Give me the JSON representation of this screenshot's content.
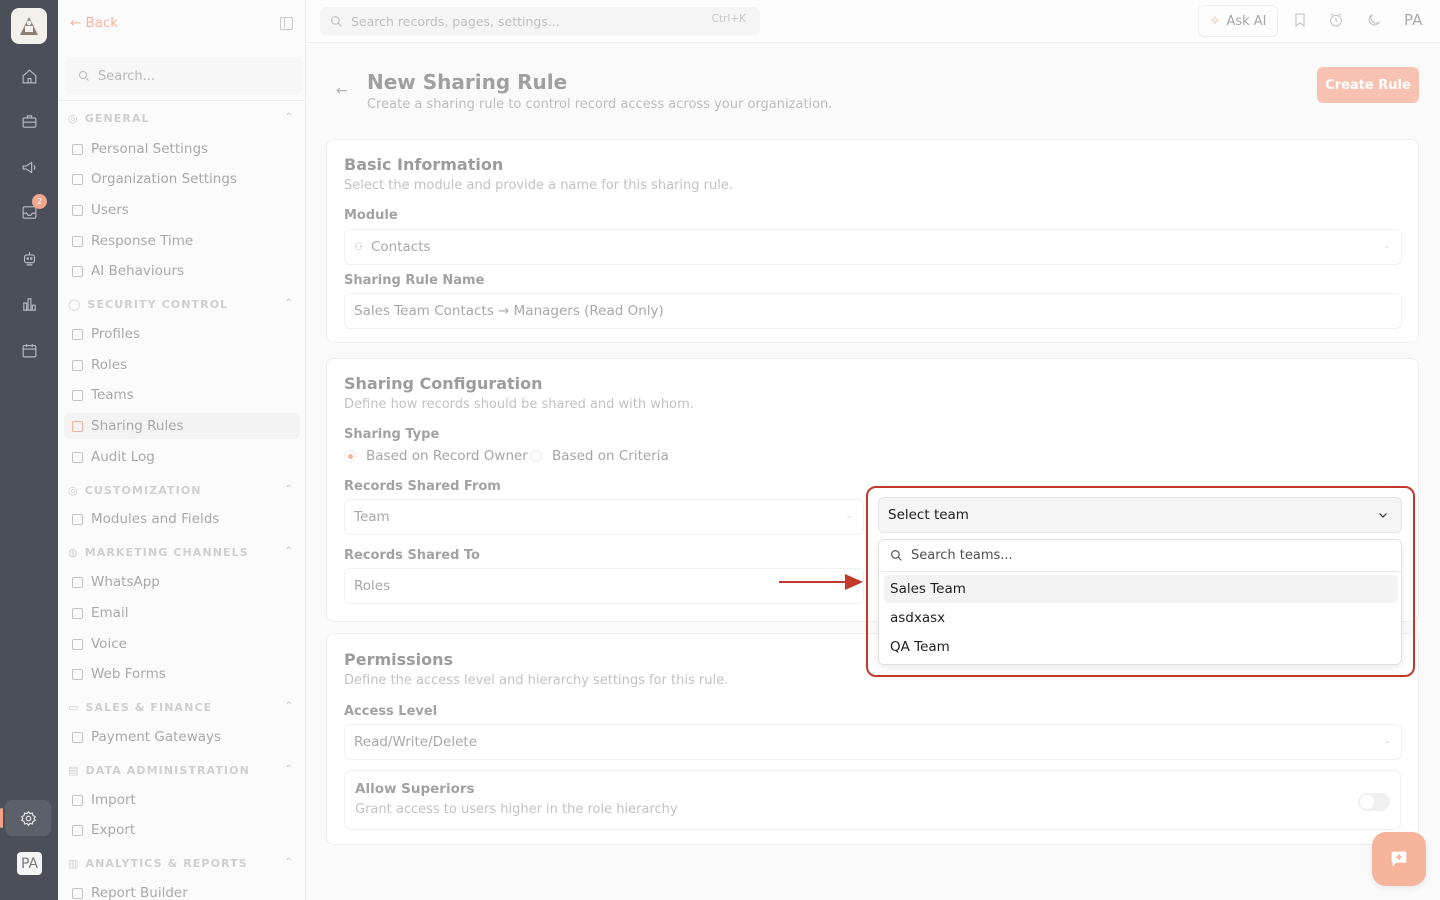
{
  "rail": {
    "items": [
      "home-icon",
      "briefcase-icon",
      "megaphone-icon",
      "inbox-icon",
      "robot-icon",
      "analytics-icon",
      "calendar-icon"
    ],
    "inbox_badge": "2",
    "avatar": "PA"
  },
  "sidebar": {
    "back_label": "Back",
    "search_placeholder": "Search...",
    "sections": [
      {
        "title": "GENERAL",
        "items": [
          "Personal Settings",
          "Organization Settings",
          "Users",
          "Response Time",
          "AI Behaviours"
        ]
      },
      {
        "title": "SECURITY CONTROL",
        "items": [
          "Profiles",
          "Roles",
          "Teams",
          "Sharing Rules",
          "Audit Log"
        ]
      },
      {
        "title": "CUSTOMIZATION",
        "items": [
          "Modules and Fields"
        ]
      },
      {
        "title": "MARKETING CHANNELS",
        "items": [
          "WhatsApp",
          "Email",
          "Voice",
          "Web Forms"
        ]
      },
      {
        "title": "SALES & FINANCE",
        "items": [
          "Payment Gateways"
        ]
      },
      {
        "title": "DATA ADMINISTRATION",
        "items": [
          "Import",
          "Export"
        ]
      },
      {
        "title": "ANALYTICS & REPORTS",
        "items": [
          "Report Builder"
        ]
      }
    ],
    "active_item": "Sharing Rules"
  },
  "topbar": {
    "search_placeholder": "Search records, pages, settings...",
    "shortcut": "Ctrl+K",
    "ask_ai": "Ask AI",
    "user_initials": "PA"
  },
  "page": {
    "title": "New Sharing Rule",
    "subtitle": "Create a sharing rule to control record access across your organization.",
    "create_button": "Create Rule"
  },
  "basic_info": {
    "title": "Basic Information",
    "subtitle": "Select the module and provide a name for this sharing rule.",
    "module_label": "Module",
    "module_value": "Contacts",
    "name_label": "Sharing Rule Name",
    "name_value": "Sales Team Contacts → Managers (Read Only)"
  },
  "sharing_config": {
    "title": "Sharing Configuration",
    "subtitle": "Define how records should be shared and with whom.",
    "type_label": "Sharing Type",
    "type_options": [
      "Based on Record Owner",
      "Based on Criteria"
    ],
    "type_selected": "Based on Record Owner",
    "from_label": "Records Shared From",
    "from_value": "Team",
    "to_label": "Records Shared To",
    "to_value": "Roles"
  },
  "team_dropdown": {
    "value": "Select team",
    "search_placeholder": "Search teams...",
    "options": [
      "Sales Team",
      "asdxasx",
      "QA Team"
    ],
    "highlighted": "Sales Team"
  },
  "permissions": {
    "title": "Permissions",
    "subtitle": "Define the access level and hierarchy settings for this rule.",
    "access_label": "Access Level",
    "access_value": "Read/Write/Delete",
    "superiors_title": "Allow Superiors",
    "superiors_desc": "Grant access to users higher in the role hierarchy",
    "superiors_enabled": false
  },
  "colors": {
    "accent": "#f3a189",
    "highlight_box": "#c0392b"
  }
}
